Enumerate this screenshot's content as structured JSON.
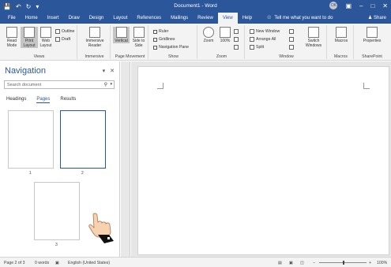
{
  "titlebar": {
    "title": "Document1 - Word",
    "avatar": "OK",
    "quick_access": [
      "save-icon",
      "undo-icon",
      "redo-icon",
      "customize-icon"
    ]
  },
  "ribbon_tabs": {
    "items": [
      "File",
      "Home",
      "Insert",
      "Draw",
      "Design",
      "Layout",
      "References",
      "Mailings",
      "Review",
      "View",
      "Help"
    ],
    "active": "View",
    "tell_me": "Tell me what you want to do",
    "share": "Share"
  },
  "ribbon": {
    "views": {
      "label": "Views",
      "read_mode": "Read Mode",
      "print_layout": "Print Layout",
      "web_layout": "Web Layout",
      "outline": "Outline",
      "draft": "Draft"
    },
    "immersive": {
      "label": "Immersive",
      "reader": "Immersive Reader"
    },
    "page_movement": {
      "label": "Page Movement",
      "vertical": "Vertical",
      "side_to_side": "Side to Side"
    },
    "show": {
      "label": "Show",
      "ruler": "Ruler",
      "gridlines": "Gridlines",
      "navigation_pane": "Navigation Pane"
    },
    "zoom": {
      "label": "Zoom",
      "zoom": "Zoom",
      "hundred": "100%"
    },
    "window": {
      "label": "Window",
      "new_window": "New Window",
      "arrange_all": "Arrange All",
      "split": "Split",
      "switch_windows": "Switch Windows"
    },
    "macros": {
      "label": "Macros",
      "macros": "Macros"
    },
    "sharepoint": {
      "label": "SharePoint",
      "properties": "Properties"
    }
  },
  "navigation": {
    "title": "Navigation",
    "search_placeholder": "Search document",
    "tabs": [
      "Headings",
      "Pages",
      "Results"
    ],
    "active_tab": "Pages",
    "pages": [
      "1",
      "2",
      "3"
    ],
    "selected_page": "2"
  },
  "statusbar": {
    "page": "Page 2 of 3",
    "words": "0 words",
    "language": "English (United States)",
    "zoom": "100%"
  },
  "colors": {
    "brand": "#2b579a",
    "ribbon_bg": "#f3f3f3",
    "doc_bg": "#e6e6e6"
  }
}
